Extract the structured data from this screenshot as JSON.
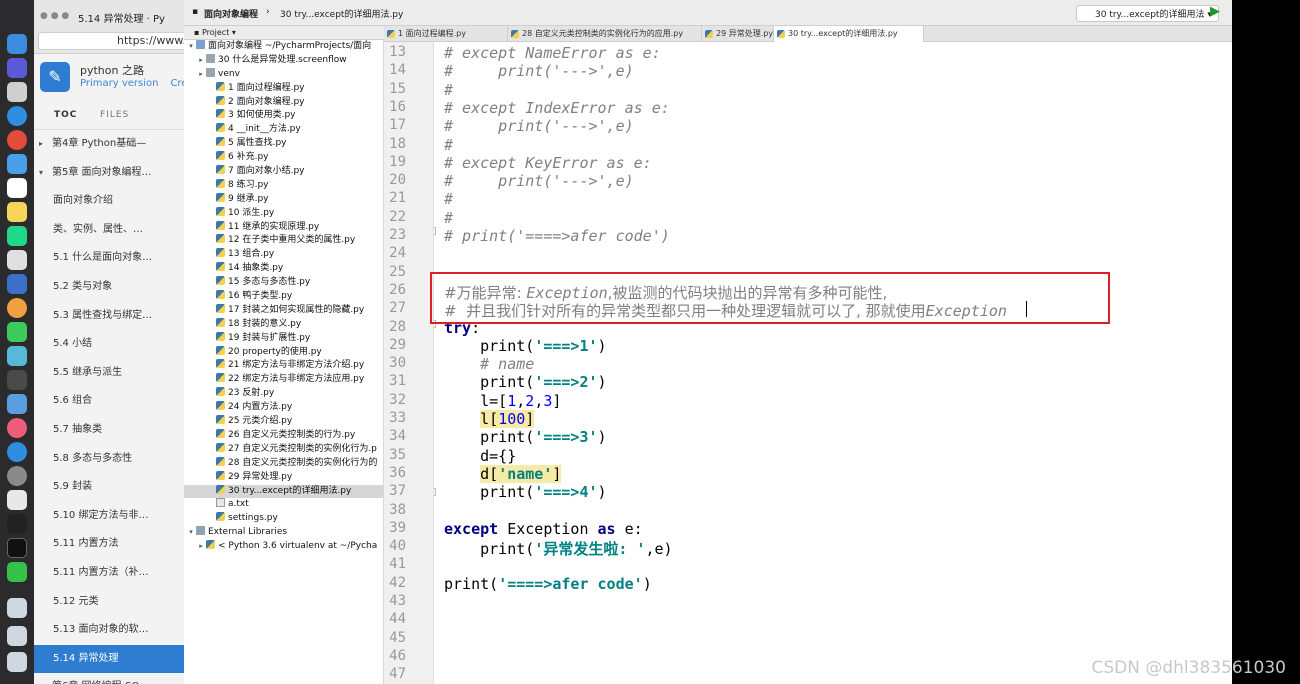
{
  "browser": {
    "tab_title": "5.14 异常处理 · Py",
    "url": "https://www.g"
  },
  "book": {
    "title": "python 之路",
    "version": "Primary version",
    "create_label": "Cre",
    "tabs": [
      "TOC",
      "FILES"
    ],
    "toc": [
      {
        "label": "第4章 Python基础—",
        "kind": "chapter",
        "caret": "▸"
      },
      {
        "label": "第5章 面向对象编程…",
        "kind": "chapter",
        "caret": "▾"
      },
      {
        "label": "面向对象介绍",
        "kind": "item"
      },
      {
        "label": "类、实例、属性、…",
        "kind": "item"
      },
      {
        "label": "5.1 什么是面向对象…",
        "kind": "item"
      },
      {
        "label": "5.2 类与对象",
        "kind": "item"
      },
      {
        "label": "5.3 属性查找与绑定…",
        "kind": "item"
      },
      {
        "label": "5.4 小结",
        "kind": "item"
      },
      {
        "label": "5.5 继承与派生",
        "kind": "item"
      },
      {
        "label": "5.6 组合",
        "kind": "item"
      },
      {
        "label": "5.7 抽象类",
        "kind": "item"
      },
      {
        "label": "5.8 多态与多态性",
        "kind": "item"
      },
      {
        "label": "5.9 封装",
        "kind": "item"
      },
      {
        "label": "5.10 绑定方法与非…",
        "kind": "item"
      },
      {
        "label": "5.11 内置方法",
        "kind": "item"
      },
      {
        "label": "5.11 内置方法（补…",
        "kind": "item"
      },
      {
        "label": "5.12 元类",
        "kind": "item"
      },
      {
        "label": "5.13 面向对象的软…",
        "kind": "item"
      },
      {
        "label": "5.14 异常处理",
        "kind": "item",
        "active": true
      },
      {
        "label": "第6章 网络编程-SO",
        "kind": "chapter",
        "caret": "▸"
      }
    ]
  },
  "ide": {
    "breadcrumb": [
      "面向对象编程",
      "30 try...except的详细用法.py"
    ],
    "run_config": "30 try...except的详细用法",
    "project_header": "Project",
    "tree": [
      {
        "label": "面向对象编程  ~/PycharmProjects/面向",
        "icon": "folder-blue",
        "arrow": "▾",
        "indent": 0
      },
      {
        "label": "30 什么是异常处理.screenflow",
        "icon": "folder",
        "arrow": "▸",
        "indent": 1
      },
      {
        "label": "venv",
        "icon": "folder",
        "arrow": "▸",
        "indent": 1
      },
      {
        "label": "1 面向过程编程.py",
        "icon": "py",
        "arrow": "",
        "indent": 2
      },
      {
        "label": "2 面向对象编程.py",
        "icon": "py",
        "arrow": "",
        "indent": 2
      },
      {
        "label": "3 如何使用类.py",
        "icon": "py",
        "arrow": "",
        "indent": 2
      },
      {
        "label": "4 __init__方法.py",
        "icon": "py",
        "arrow": "",
        "indent": 2
      },
      {
        "label": "5 属性查找.py",
        "icon": "py",
        "arrow": "",
        "indent": 2
      },
      {
        "label": "6 补充.py",
        "icon": "py",
        "arrow": "",
        "indent": 2
      },
      {
        "label": "7 面向对象小结.py",
        "icon": "py",
        "arrow": "",
        "indent": 2
      },
      {
        "label": "8 练习.py",
        "icon": "py",
        "arrow": "",
        "indent": 2
      },
      {
        "label": "9 继承.py",
        "icon": "py",
        "arrow": "",
        "indent": 2
      },
      {
        "label": "10 派生.py",
        "icon": "py",
        "arrow": "",
        "indent": 2
      },
      {
        "label": "11 继承的实现原理.py",
        "icon": "py",
        "arrow": "",
        "indent": 2
      },
      {
        "label": "12 在子类中重用父类的属性.py",
        "icon": "py",
        "arrow": "",
        "indent": 2
      },
      {
        "label": "13 组合.py",
        "icon": "py",
        "arrow": "",
        "indent": 2
      },
      {
        "label": "14 抽象类.py",
        "icon": "py",
        "arrow": "",
        "indent": 2
      },
      {
        "label": "15 多态与多态性.py",
        "icon": "py",
        "arrow": "",
        "indent": 2
      },
      {
        "label": "16 鸭子类型.py",
        "icon": "py",
        "arrow": "",
        "indent": 2
      },
      {
        "label": "17 封装之如何实现属性的隐藏.py",
        "icon": "py",
        "arrow": "",
        "indent": 2
      },
      {
        "label": "18 封装的意义.py",
        "icon": "py",
        "arrow": "",
        "indent": 2
      },
      {
        "label": "19 封装与扩展性.py",
        "icon": "py",
        "arrow": "",
        "indent": 2
      },
      {
        "label": "20 property的使用.py",
        "icon": "py",
        "arrow": "",
        "indent": 2
      },
      {
        "label": "21 绑定方法与非绑定方法介绍.py",
        "icon": "py",
        "arrow": "",
        "indent": 2
      },
      {
        "label": "22 绑定方法与非绑定方法应用.py",
        "icon": "py",
        "arrow": "",
        "indent": 2
      },
      {
        "label": "23 反射.py",
        "icon": "py",
        "arrow": "",
        "indent": 2
      },
      {
        "label": "24 内置方法.py",
        "icon": "py",
        "arrow": "",
        "indent": 2
      },
      {
        "label": "25 元类介绍.py",
        "icon": "py",
        "arrow": "",
        "indent": 2
      },
      {
        "label": "26 自定义元类控制类的行为.py",
        "icon": "py",
        "arrow": "",
        "indent": 2
      },
      {
        "label": "27 自定义元类控制类的实例化行为.p",
        "icon": "py",
        "arrow": "",
        "indent": 2
      },
      {
        "label": "28 自定义元类控制类的实例化行为的",
        "icon": "py",
        "arrow": "",
        "indent": 2
      },
      {
        "label": "29 异常处理.py",
        "icon": "py",
        "arrow": "",
        "indent": 2
      },
      {
        "label": "30 try...except的详细用法.py",
        "icon": "py",
        "arrow": "",
        "indent": 2,
        "selected": true
      },
      {
        "label": "a.txt",
        "icon": "txt",
        "arrow": "",
        "indent": 2
      },
      {
        "label": "settings.py",
        "icon": "py",
        "arrow": "",
        "indent": 2
      },
      {
        "label": "External Libraries",
        "icon": "lib",
        "arrow": "▾",
        "indent": 0
      },
      {
        "label": "< Python 3.6 virtualenv at ~/Pycha",
        "icon": "py",
        "arrow": "▸",
        "indent": 1
      }
    ],
    "tabs": [
      {
        "label": "1 面向过程编程.py",
        "active": false
      },
      {
        "label": "28 自定义元类控制类的实例化行为的应用.py",
        "active": false
      },
      {
        "label": "29 异常处理.py",
        "active": false
      },
      {
        "label": "30 try...except的详细用法.py",
        "active": true
      }
    ],
    "line_numbers": [
      "13",
      "14",
      "15",
      "16",
      "17",
      "18",
      "19",
      "20",
      "21",
      "22",
      "23",
      "24",
      "25",
      "26",
      "27",
      "28",
      "29",
      "30",
      "31",
      "32",
      "33",
      "34",
      "35",
      "36",
      "37",
      "38",
      "39",
      "40",
      "41",
      "42",
      "43",
      "44",
      "45",
      "46",
      "47"
    ]
  },
  "code_lines": {
    "l13": "# except NameError as e:",
    "l14": "#     print('--->',e)",
    "l15": "#",
    "l16": "# except IndexError as e:",
    "l17": "#     print('--->',e)",
    "l18": "#",
    "l19": "# except KeyError as e:",
    "l20": "#     print('--->',e)",
    "l21": "#",
    "l22": "#",
    "l23": "# print('====>afer code')",
    "l26_hash": "#万能异常: ",
    "l26_exc": "Exception",
    "l26_rest": ",被监测的代码块抛出的异常有多种可能性,",
    "l27_hash": "#  并且我们针对所有的异常类型都只用一种处理逻辑就可以了, 那就使用",
    "l27_exc": "Exception",
    "l28": "try",
    "l28_colon": ":",
    "print": "print",
    "l29_str": "'===>1'",
    "l30": "# name",
    "l31_str": "'===>2'",
    "l32_a": "l=[",
    "l32_n1": "1",
    "l32_n2": "2",
    "l32_n3": "3",
    "l33_a": "l[",
    "l33_n": "100",
    "l33_b": "]",
    "l34_str": "'===>3'",
    "l35": "d={}",
    "l36_a": "d[",
    "l36_s": "'name'",
    "l36_b": "]",
    "l37_str": "'===>4'",
    "l39_kw1": "except",
    "l39_mid": " Exception ",
    "l39_kw2": "as",
    "l39_end": " e:",
    "l40_str": "'异常发生啦: '",
    "l40_end": ",e)",
    "l42_str": "'====>afer code'"
  },
  "watermark": "CSDN @dhl383561030"
}
